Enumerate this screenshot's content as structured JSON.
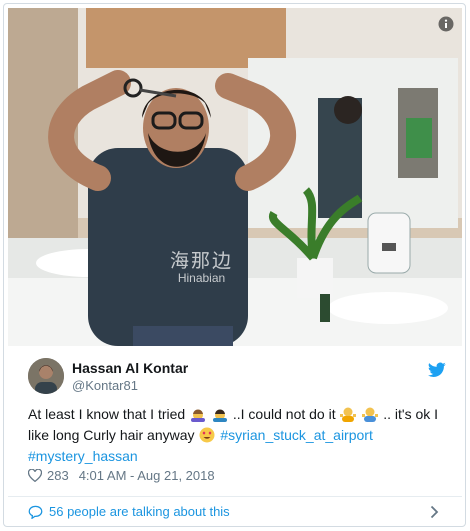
{
  "tweet": {
    "author_name": "Hassan Al Kontar",
    "author_handle": "@Kontar81",
    "text_part1": "At least I know that I tried",
    "text_part2": "..I could not do it",
    "text_part3": ".. it's ok I like long Curly hair anyway",
    "hashtag1": "#syrian_stuck_at_airport",
    "hashtag2": "#mystery_hassan",
    "likes": "283",
    "timestamp": "4:01 AM - Aug 21, 2018",
    "talking": "56 people are talking about this"
  },
  "photo": {
    "watermark_cn": "海那边",
    "watermark_en": "Hinabian"
  },
  "icons": {
    "info": "info-icon",
    "bird": "twitter-bird-icon",
    "heart": "heart-icon",
    "bubble": "speech-bubble-icon",
    "chevron": "chevron-right-icon",
    "emoji_barber": "haircut-emoji",
    "emoji_shrug": "shrug-emoji",
    "emoji_heart_eyes": "heart-eyes-emoji"
  },
  "colors": {
    "link": "#1b95e0",
    "muted": "#657786",
    "text": "#14171a"
  }
}
